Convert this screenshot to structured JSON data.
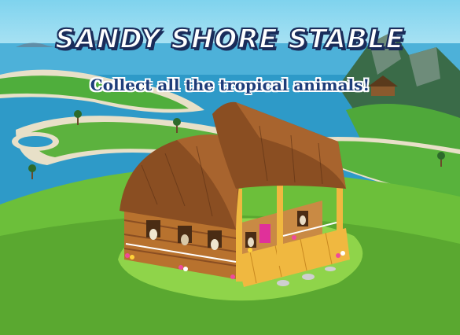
{
  "banner": {
    "title": "SANDY SHORE STABLE",
    "subtitle": "Collect all the tropical animals!"
  },
  "colors": {
    "ocean": "#2e9ac8",
    "grass": "#6cbf3a",
    "roof": "#8a4e22",
    "wood": "#b8722e",
    "door": "#e0309a",
    "title_outline": "#1a2c5a"
  },
  "icons": {
    "stable": "stable-building",
    "island": "tropical-island"
  }
}
